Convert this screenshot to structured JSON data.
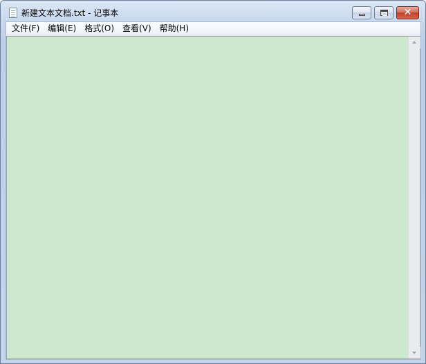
{
  "window": {
    "title": "新建文本文档.txt - 记事本",
    "buttons": {
      "minimize": "minimize",
      "maximize": "maximize",
      "close": "✕"
    }
  },
  "menu": {
    "items": [
      {
        "label": "文件(F)"
      },
      {
        "label": "编辑(E)"
      },
      {
        "label": "格式(O)"
      },
      {
        "label": "查看(V)"
      },
      {
        "label": "帮助(H)"
      }
    ]
  },
  "editor": {
    "content": "",
    "background": "#cce8cf"
  },
  "icons": {
    "app": "notepad-document-icon",
    "close": "close-icon",
    "minimize": "minimize-icon",
    "maximize": "maximize-icon"
  }
}
